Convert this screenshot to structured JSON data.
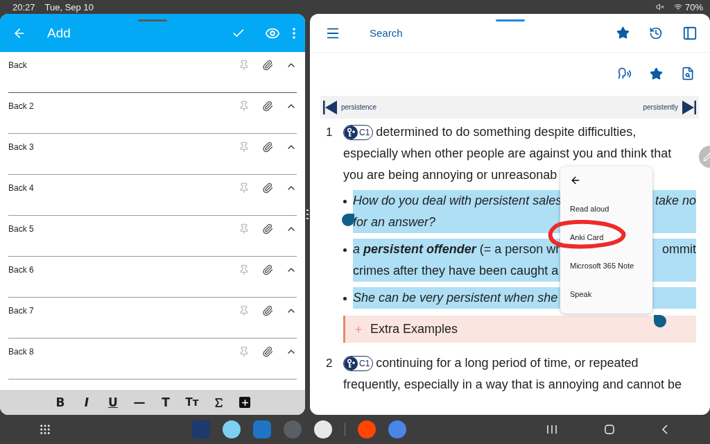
{
  "status_bar": {
    "time": "20:27",
    "date": "Tue, Sep 10",
    "battery": "70%"
  },
  "editor": {
    "title": "Add",
    "fields": [
      {
        "label": "Back",
        "focused": true
      },
      {
        "label": "Back 2",
        "focused": false
      },
      {
        "label": "Back 3",
        "focused": false
      },
      {
        "label": "Back 4",
        "focused": false
      },
      {
        "label": "Back 5",
        "focused": false
      },
      {
        "label": "Back 6",
        "focused": false
      },
      {
        "label": "Back 7",
        "focused": false
      },
      {
        "label": "Back 8",
        "focused": false
      }
    ],
    "format_buttons": [
      {
        "kind": "bold",
        "label": "B"
      },
      {
        "kind": "italic",
        "label": "I"
      },
      {
        "kind": "underline",
        "label": "U"
      },
      {
        "kind": "rule",
        "label": "—"
      },
      {
        "kind": "title",
        "label": "T"
      },
      {
        "kind": "caps",
        "label": "Tт"
      },
      {
        "kind": "formula"
      },
      {
        "kind": "insert"
      }
    ]
  },
  "dictionary": {
    "title": "Search",
    "prev": "persistence",
    "next": "persistently",
    "senses": [
      {
        "number": "1",
        "cefr": "C1",
        "lines": [
          [
            "determined to do something despite difficulties,"
          ],
          [
            "especially when other people are against you and think that"
          ],
          [
            "you are being annoying or unreasonab"
          ]
        ],
        "examples": [
          {
            "italic": true,
            "selected": true,
            "lines": [
              [
                "How do you deal with persistent sales",
                "take no"
              ],
              [
                "for an answer?"
              ]
            ]
          },
          {
            "italic": false,
            "selected": true,
            "lines": [
              [
                "*a* **persistent offender** (= a person wh",
                "ommit"
              ],
              [
                "crimes after they have been caught a"
              ]
            ]
          },
          {
            "italic": true,
            "selected": true,
            "lines": [
              [
                "She can be very persistent when she"
              ]
            ]
          }
        ],
        "extra": "Extra Examples"
      },
      {
        "number": "2",
        "cefr": "C1",
        "lines": [
          [
            "continuing for a long period of time, or repeated"
          ],
          [
            "frequently, especially in a way that is annoying and cannot be"
          ]
        ]
      }
    ]
  },
  "context_menu": {
    "items": [
      {
        "label": "Read aloud",
        "circled": false
      },
      {
        "label": "Anki Card",
        "circled": true
      },
      {
        "label": "Microsoft 365 Note",
        "circled": false
      },
      {
        "label": "Speak",
        "circled": false
      }
    ]
  }
}
